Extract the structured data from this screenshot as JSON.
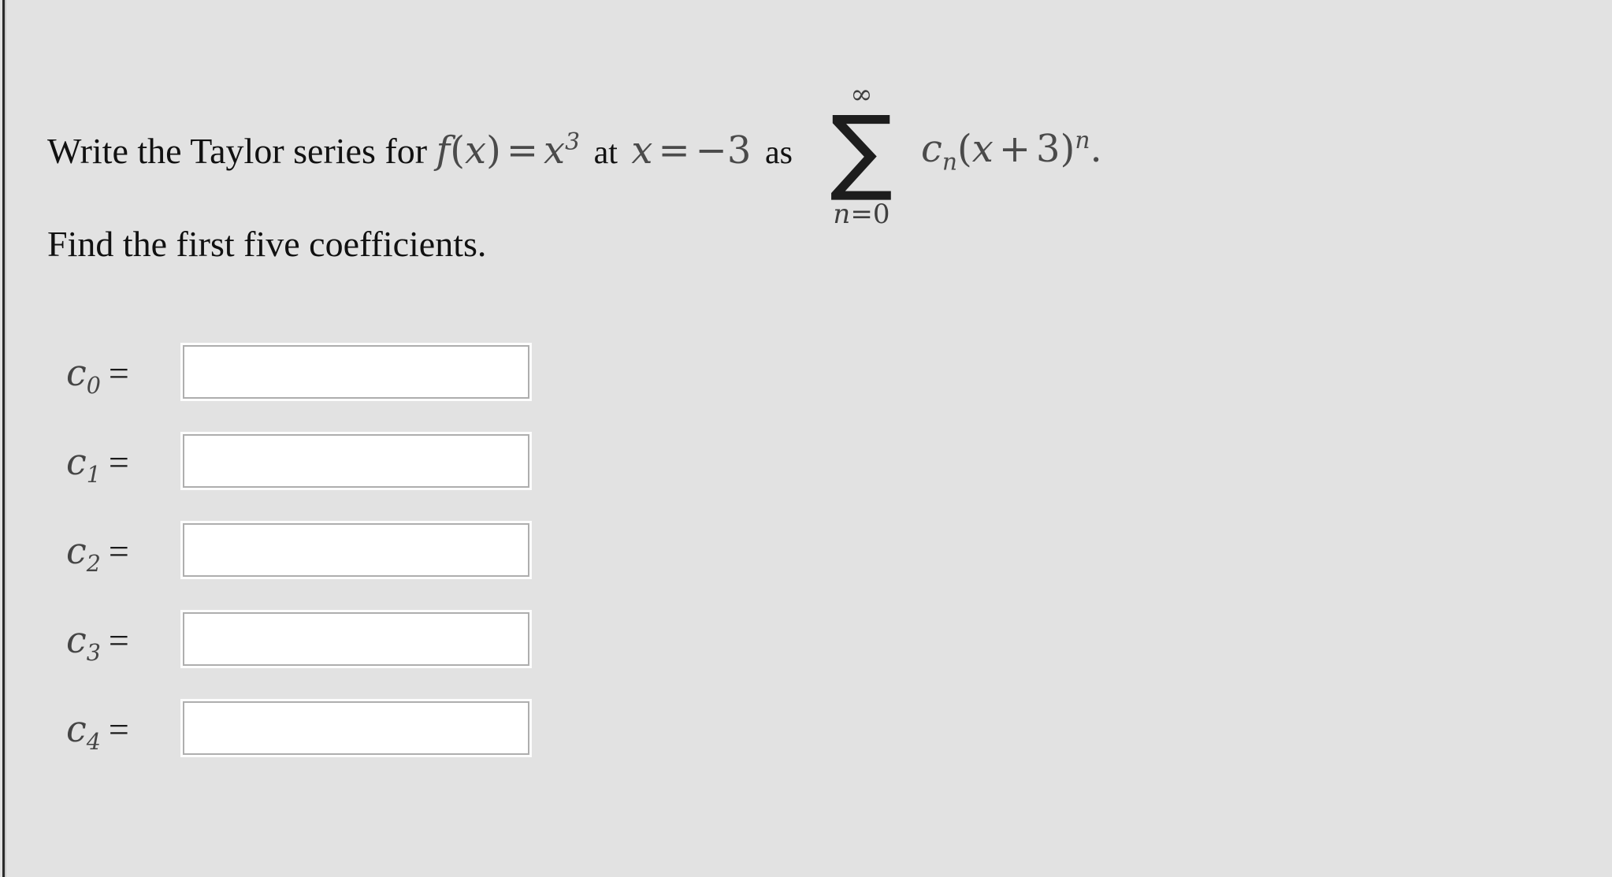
{
  "problem": {
    "line1": {
      "lead_text": "Write the Taylor series for",
      "function_f": "f",
      "paren_open": "(",
      "variable_x": "x",
      "paren_close": ")",
      "equals": "=",
      "expression_base": "x",
      "expression_exponent": "3",
      "word_at": "at",
      "point_variable": "x",
      "point_equals": "=",
      "point_value": "−3",
      "word_as": "as",
      "sum_upper_limit": "∞",
      "sum_symbol": "∑",
      "sum_index": "n",
      "sum_lower_equals": "=",
      "sum_lower_value": "0",
      "term_coefficient": "c",
      "term_coefficient_index": "n",
      "term_paren_open": "(",
      "term_variable": "x",
      "term_plus": "+",
      "term_constant": "3",
      "term_paren_close": ")",
      "term_exponent": "n",
      "period": "."
    },
    "line2": "Find the first five coefficients."
  },
  "answers": {
    "rows": [
      {
        "symbol": "c",
        "index": "0",
        "equals": "=",
        "value": "",
        "placeholder": ""
      },
      {
        "symbol": "c",
        "index": "1",
        "equals": "=",
        "value": "",
        "placeholder": ""
      },
      {
        "symbol": "c",
        "index": "2",
        "equals": "=",
        "value": "",
        "placeholder": ""
      },
      {
        "symbol": "c",
        "index": "3",
        "equals": "=",
        "value": "",
        "placeholder": ""
      },
      {
        "symbol": "c",
        "index": "4",
        "equals": "=",
        "value": "",
        "placeholder": ""
      }
    ]
  },
  "colors": {
    "background": "#e2e2e2",
    "text": "#111111",
    "math_text": "#4a4a4a",
    "input_background": "#ffffff",
    "input_border": "#aeaeae",
    "left_edge_rule": "#2b2b2b"
  }
}
